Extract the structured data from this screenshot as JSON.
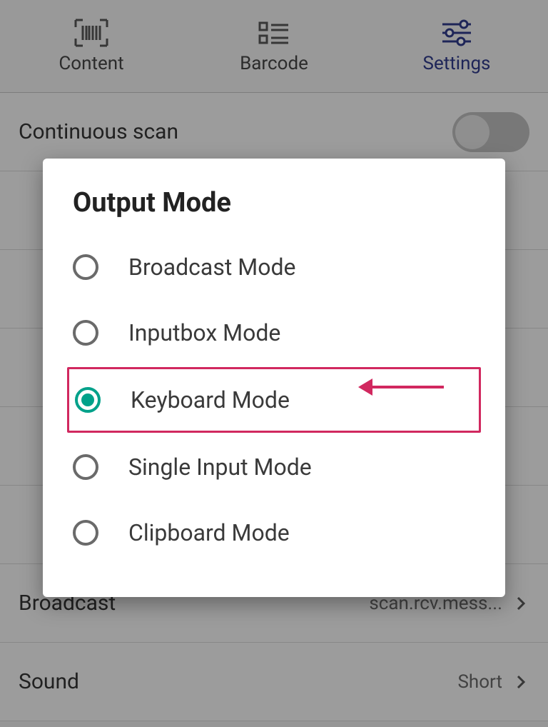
{
  "tabs": {
    "content": "Content",
    "barcode": "Barcode",
    "settings": "Settings",
    "active": "settings"
  },
  "settings_rows": {
    "continuous_scan": {
      "label": "Continuous scan",
      "enabled": false
    },
    "broadcast": {
      "label": "Broadcast",
      "value": "scan.rcv.mess..."
    },
    "sound": {
      "label": "Sound",
      "value": "Short"
    }
  },
  "modal": {
    "title": "Output Mode",
    "options": [
      {
        "label": "Broadcast Mode",
        "selected": false
      },
      {
        "label": "Inputbox Mode",
        "selected": false
      },
      {
        "label": "Keyboard Mode",
        "selected": true,
        "highlighted": true
      },
      {
        "label": "Single Input Mode",
        "selected": false
      },
      {
        "label": "Clipboard Mode",
        "selected": false
      }
    ]
  },
  "colors": {
    "accent": "#2e3a87",
    "radio_selected": "#00a18a",
    "highlight": "#d1285f"
  }
}
